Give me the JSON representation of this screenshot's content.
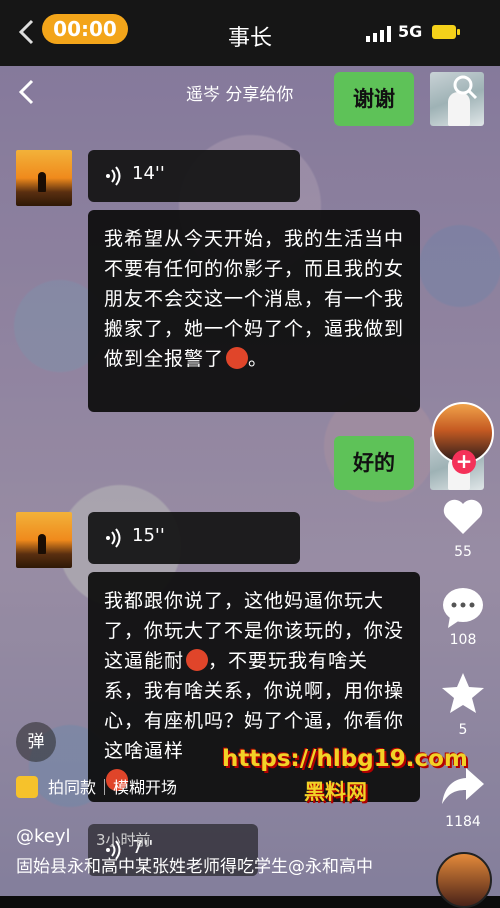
{
  "status": {
    "time": "00:00",
    "title": "事长",
    "network": "5G"
  },
  "header": {
    "share_text": "遥岑 分享给你"
  },
  "messages": [
    {
      "type": "sent",
      "text": "谢谢"
    },
    {
      "type": "voice",
      "duration": "14''"
    },
    {
      "type": "text",
      "text": "我希望从今天开始，我的生活当中不要有任何的你影子，而且我的女朋友不会交这一个消息，有一个我搬家了，她一个妈了个，逼我做到做到全报警了",
      "suffix": "。"
    },
    {
      "type": "sent",
      "text": "好的"
    },
    {
      "type": "voice",
      "duration": "15''"
    },
    {
      "type": "text",
      "text_a": "我都跟你说了，这他妈逼你玩大了，你玩大了不是你该玩的，你没这逼能耐",
      "text_b": "，不要玩我有啥关系，我有啥关系，你说啊，用你操心，有座机吗？妈了个逼，你看你这啥逼样"
    },
    {
      "type": "voice",
      "duration": "7''"
    }
  ],
  "rail": {
    "likes": "55",
    "comments": "108",
    "favorites": "5",
    "shares": "1184"
  },
  "danmu_label": "弹",
  "tags": {
    "same_style": "拍同款",
    "effect": "模糊开场"
  },
  "watermark": {
    "url": "https://hlbg19.com",
    "name": "黑料网"
  },
  "post": {
    "author": "@keyl",
    "time": "3小时前",
    "caption": "固始县永和高中某张姓老师得吃学生@永和高中"
  },
  "colors": {
    "accent_green": "#5ec258",
    "pill": "#f3a51a",
    "follow": "#f43159"
  }
}
